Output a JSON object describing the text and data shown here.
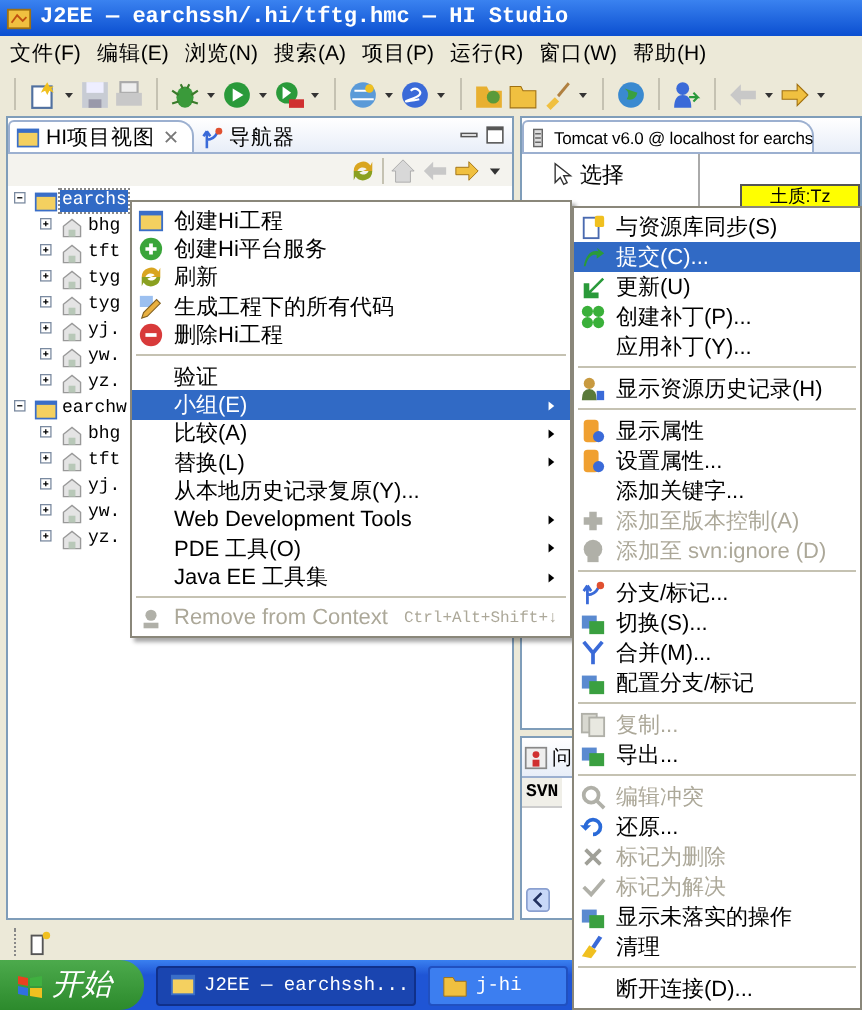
{
  "window": {
    "title": "J2EE — earchssh/.hi/tftg.hmc — HI Studio"
  },
  "menu_bar": [
    {
      "label": "文件(F)"
    },
    {
      "label": "编辑(E)"
    },
    {
      "label": "浏览(N)"
    },
    {
      "label": "搜索(A)"
    },
    {
      "label": "项目(P)"
    },
    {
      "label": "运行(R)"
    },
    {
      "label": "窗口(W)"
    },
    {
      "label": "帮助(H)"
    }
  ],
  "project_view": {
    "tabs": [
      {
        "label": "HI项目视图",
        "selected": true
      },
      {
        "label": "导航器",
        "selected": false
      }
    ],
    "tree": [
      {
        "label": "earchs",
        "selected": true,
        "expanded": true,
        "children": [
          {
            "label": "bhg",
            "selected": false,
            "expanded": false
          },
          {
            "label": "tft",
            "selected": false,
            "expanded": false
          },
          {
            "label": "tyg",
            "selected": false,
            "expanded": false
          },
          {
            "label": "tyg",
            "selected": false,
            "expanded": false
          },
          {
            "label": "yj.",
            "selected": false,
            "expanded": false
          },
          {
            "label": "yw.",
            "selected": false,
            "expanded": false
          },
          {
            "label": "yz.",
            "selected": false,
            "expanded": false
          }
        ]
      },
      {
        "label": "earchw",
        "selected": false,
        "expanded": true,
        "children": [
          {
            "label": "bhg",
            "selected": false,
            "expanded": false
          },
          {
            "label": "tft",
            "selected": false,
            "expanded": false
          },
          {
            "label": "yj.",
            "selected": false,
            "expanded": false
          },
          {
            "label": "yw.",
            "selected": false,
            "expanded": false
          },
          {
            "label": "yz.",
            "selected": false,
            "expanded": false
          }
        ]
      }
    ]
  },
  "editor": {
    "tab": "Tomcat v6.0 @ localhost for earchs",
    "palette": [
      {
        "label": "选择"
      }
    ],
    "shape_label": "土质:Tz"
  },
  "bottom_view": {
    "tab": "问",
    "column_1": "SVN"
  },
  "context_menu": {
    "items": [
      {
        "kind": "item",
        "label": "创建Hi工程",
        "selected": false,
        "disabled": false
      },
      {
        "kind": "item",
        "label": "创建Hi平台服务",
        "selected": false,
        "disabled": false
      },
      {
        "kind": "item",
        "label": "刷新",
        "selected": false,
        "disabled": false
      },
      {
        "kind": "item",
        "label": "生成工程下的所有代码",
        "selected": false,
        "disabled": false
      },
      {
        "kind": "item",
        "label": "删除Hi工程",
        "selected": false,
        "disabled": false
      },
      {
        "kind": "separator"
      },
      {
        "kind": "item",
        "label": "验证",
        "selected": false,
        "disabled": false
      },
      {
        "kind": "item",
        "label": "小组(E)",
        "selected": true,
        "disabled": false,
        "submenu": true
      },
      {
        "kind": "item",
        "label": "比较(A)",
        "selected": false,
        "disabled": false,
        "submenu": true
      },
      {
        "kind": "item",
        "label": "替换(L)",
        "selected": false,
        "disabled": false,
        "submenu": true
      },
      {
        "kind": "item",
        "label": "从本地历史记录复原(Y)...",
        "selected": false,
        "disabled": false
      },
      {
        "kind": "item",
        "label": "Web Development Tools",
        "selected": false,
        "disabled": false,
        "submenu": true
      },
      {
        "kind": "item",
        "label": "PDE 工具(O)",
        "selected": false,
        "disabled": false,
        "submenu": true
      },
      {
        "kind": "item",
        "label": "Java EE 工具集",
        "selected": false,
        "disabled": false,
        "submenu": true
      },
      {
        "kind": "separator"
      },
      {
        "kind": "item",
        "label": "Remove from Context",
        "shortcut": "Ctrl+Alt+Shift+↓",
        "selected": false,
        "disabled": true
      }
    ]
  },
  "submenu": {
    "items": [
      {
        "kind": "item",
        "label": "与资源库同步(S)",
        "selected": false,
        "disabled": false
      },
      {
        "kind": "item",
        "label": "提交(C)...",
        "selected": true,
        "disabled": false
      },
      {
        "kind": "item",
        "label": "更新(U)",
        "selected": false,
        "disabled": false
      },
      {
        "kind": "item",
        "label": "创建补丁(P)...",
        "selected": false,
        "disabled": false
      },
      {
        "kind": "item",
        "label": "应用补丁(Y)...",
        "selected": false,
        "disabled": false
      },
      {
        "kind": "separator"
      },
      {
        "kind": "item",
        "label": "显示资源历史记录(H)",
        "selected": false,
        "disabled": false
      },
      {
        "kind": "separator"
      },
      {
        "kind": "item",
        "label": "显示属性",
        "selected": false,
        "disabled": false
      },
      {
        "kind": "item",
        "label": "设置属性...",
        "selected": false,
        "disabled": false
      },
      {
        "kind": "item",
        "label": "添加关键字...",
        "selected": false,
        "disabled": false
      },
      {
        "kind": "item",
        "label": "添加至版本控制(A)",
        "selected": false,
        "disabled": true
      },
      {
        "kind": "item",
        "label": "添加至 svn:ignore (D)",
        "selected": false,
        "disabled": true
      },
      {
        "kind": "separator"
      },
      {
        "kind": "item",
        "label": "分支/标记...",
        "selected": false,
        "disabled": false
      },
      {
        "kind": "item",
        "label": "切换(S)...",
        "selected": false,
        "disabled": false
      },
      {
        "kind": "item",
        "label": "合并(M)...",
        "selected": false,
        "disabled": false
      },
      {
        "kind": "item",
        "label": "配置分支/标记",
        "selected": false,
        "disabled": false
      },
      {
        "kind": "separator"
      },
      {
        "kind": "item",
        "label": "复制...",
        "selected": false,
        "disabled": true
      },
      {
        "kind": "item",
        "label": "导出...",
        "selected": false,
        "disabled": false
      },
      {
        "kind": "separator"
      },
      {
        "kind": "item",
        "label": "编辑冲突",
        "selected": false,
        "disabled": true
      },
      {
        "kind": "item",
        "label": "还原...",
        "selected": false,
        "disabled": false
      },
      {
        "kind": "item",
        "label": "标记为删除",
        "selected": false,
        "disabled": true
      },
      {
        "kind": "item",
        "label": "标记为解决",
        "selected": false,
        "disabled": true
      },
      {
        "kind": "item",
        "label": "显示未落实的操作",
        "selected": false,
        "disabled": false
      },
      {
        "kind": "item",
        "label": "清理",
        "selected": false,
        "disabled": false
      },
      {
        "kind": "separator"
      },
      {
        "kind": "item",
        "label": "断开连接(D)...",
        "selected": false,
        "disabled": false
      }
    ]
  },
  "taskbar": {
    "start": "开始",
    "tasks": [
      {
        "label": "J2EE — earchssh...",
        "selected": true
      },
      {
        "label": "j-hi",
        "selected": false
      }
    ]
  }
}
